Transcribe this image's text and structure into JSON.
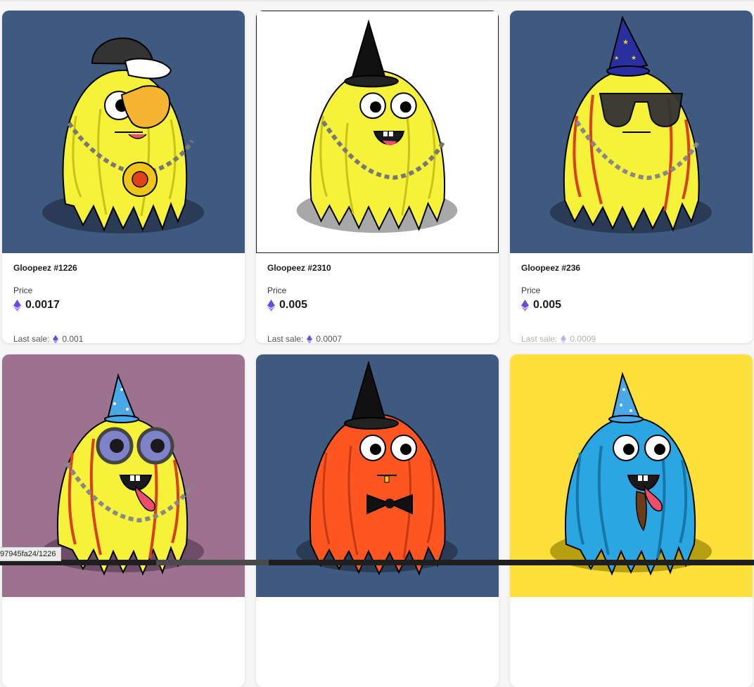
{
  "cards": [
    {
      "name": "Gloopeez #1226",
      "price_label": "Price",
      "price": "0.0017",
      "last_sale_label": "Last sale:",
      "last_sale": "0.001",
      "bg": "#3f5a80",
      "body_color": "#f6f23a",
      "shadow_color": "#2a3b55",
      "hat": "black-baseball-cap",
      "eyewear": "orange-eyepatch-shades",
      "accessory": "gold-chain-with-basketball-pendant"
    },
    {
      "name": "Gloopeez #2310",
      "price_label": "Price",
      "price": "0.005",
      "last_sale_label": "Last sale:",
      "last_sale": "0.0007",
      "bg": "#ffffff",
      "body_color": "#f6f23a",
      "shadow_color": "#a8a8a8",
      "hat": "black-witch-hat",
      "eyewear": "none",
      "accessory": "silver-chain"
    },
    {
      "name": "Gloopeez #236",
      "price_label": "Price",
      "price": "0.005",
      "last_sale_label": "Last sale:",
      "last_sale": "0.0009",
      "bg": "#3f5a80",
      "body_color": "#f6f23a",
      "shadow_color": "#2a3b55",
      "hat": "blue-wizard-hat",
      "eyewear": "dark-sunglasses",
      "accessory": "silver-chain"
    },
    {
      "bg": "#9c728f",
      "body_color": "#f6f23a",
      "shadow_color": "#6e4c66",
      "hat": "blue-party-hat",
      "eyewear": "round-glasses",
      "accessory": "silver-chain"
    },
    {
      "bg": "#3f5a80",
      "body_color": "#ff5521",
      "shadow_color": "#2a3b55",
      "hat": "black-witch-hat",
      "eyewear": "none",
      "accessory": "black-bow-tie"
    },
    {
      "bg": "#fde13a",
      "body_color": "#2aa7e3",
      "shadow_color": "#b89f12",
      "hat": "blue-party-hat",
      "eyewear": "none",
      "accessory": "none"
    }
  ],
  "status_bar": {
    "url": "97945fa24/1226"
  },
  "colors": {
    "eth_purple": "#6a4cdc",
    "eth_light": "#9b87ff"
  }
}
